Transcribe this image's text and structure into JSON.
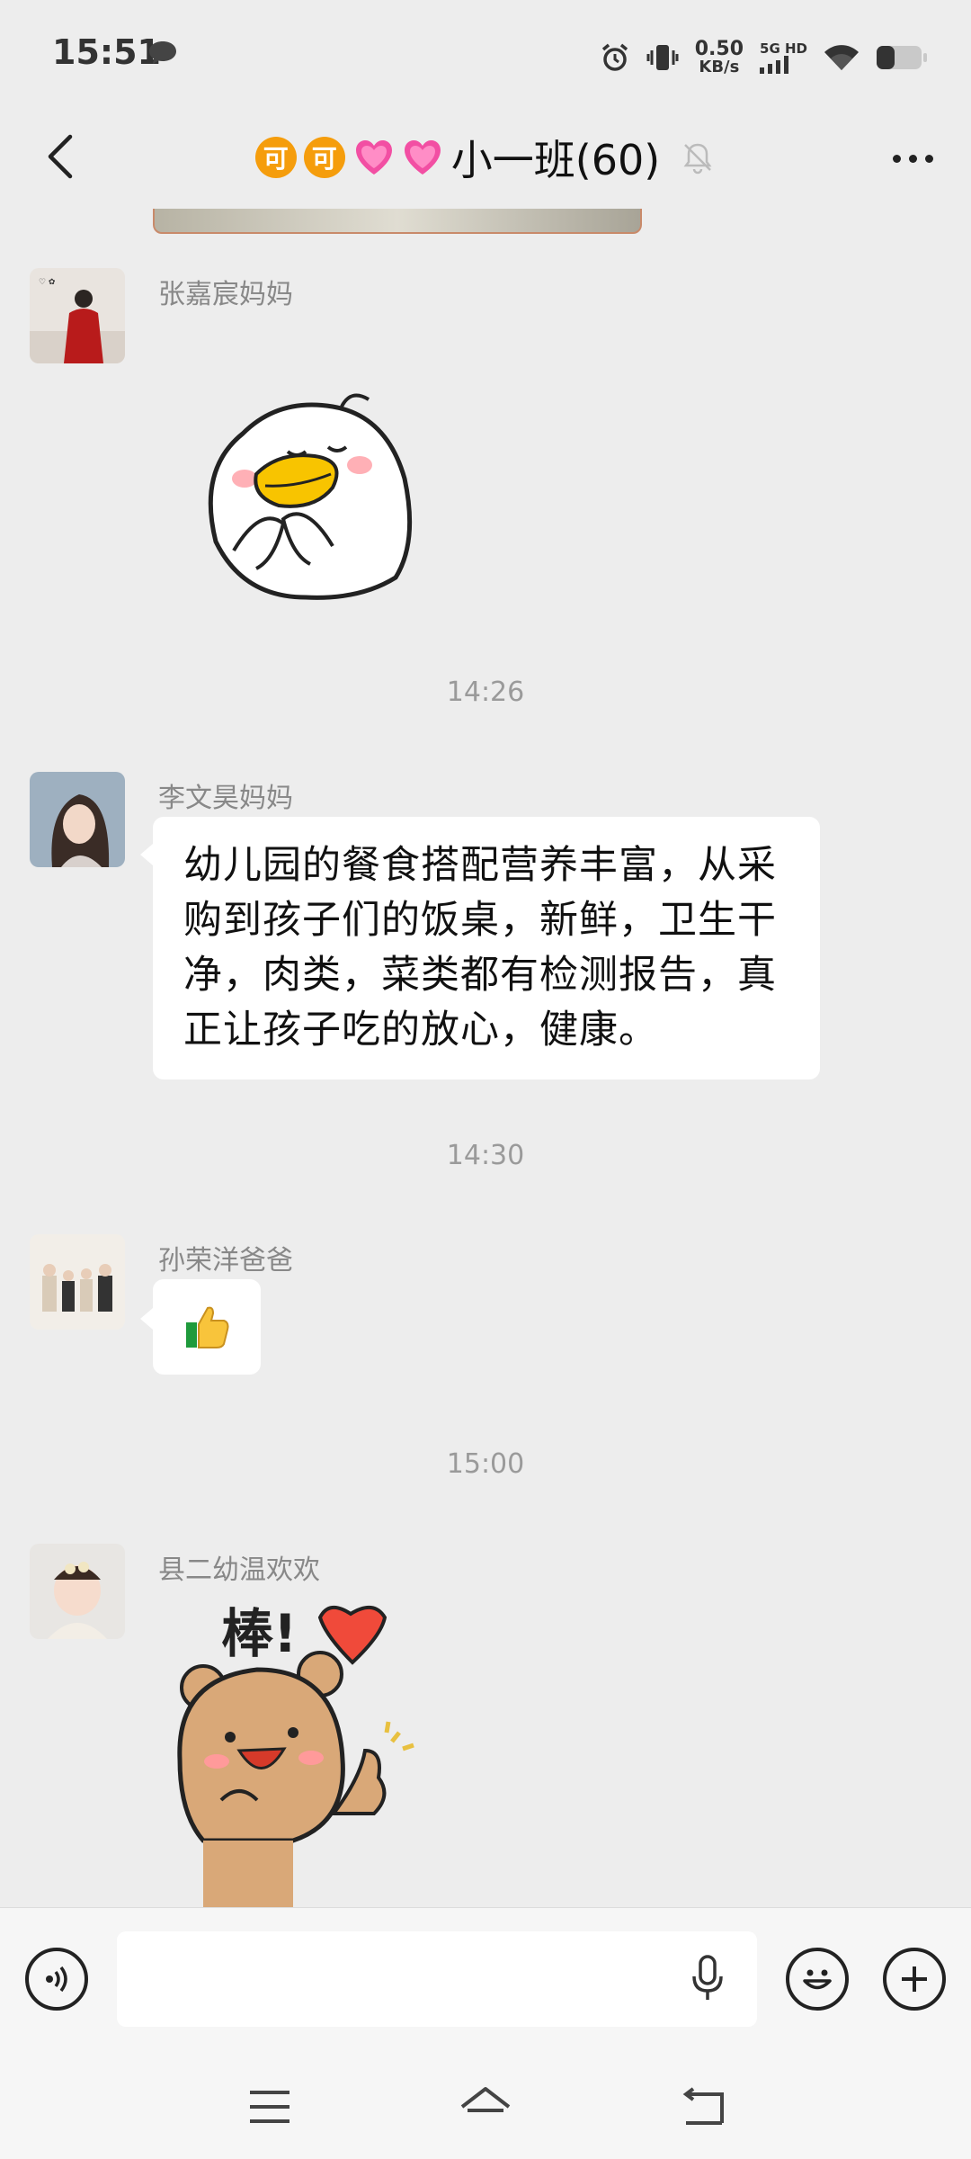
{
  "status_bar": {
    "time": "15:51",
    "net_speed_value": "0.50",
    "net_speed_unit": "KB/s",
    "signal_label": "5G HD"
  },
  "header": {
    "title_prefix_1": "可",
    "title_prefix_2": "可",
    "title": "小一班(60)"
  },
  "messages": [
    {
      "type": "sticker",
      "sender": "张嘉宸妈妈",
      "sticker": "duck-clapping"
    },
    {
      "type": "time",
      "text": "14:26"
    },
    {
      "type": "text",
      "sender": "李文昊妈妈",
      "text": "幼儿园的餐食搭配营养丰富，从采购到孩子们的饭桌，新鲜，卫生干净，肉类，菜类都有检测报告，真正让孩子吃的放心，健康。"
    },
    {
      "type": "time",
      "text": "14:30"
    },
    {
      "type": "emoji",
      "sender": "孙荣洋爸爸",
      "emoji": "👍"
    },
    {
      "type": "time",
      "text": "15:00"
    },
    {
      "type": "sticker",
      "sender": "县二幼温欢欢",
      "sticker": "bear-great",
      "sticker_text": "棒!"
    }
  ],
  "input": {
    "value": "",
    "placeholder": ""
  },
  "icons": {
    "voice": "voice-mode-icon",
    "mic": "mic-icon",
    "emoji": "emoji-icon",
    "plus": "plus-icon"
  },
  "colors": {
    "background": "#ededed",
    "bubble": "#ffffff",
    "accent_orange": "#f59d0c",
    "heart_pink": "#f24fa3"
  }
}
